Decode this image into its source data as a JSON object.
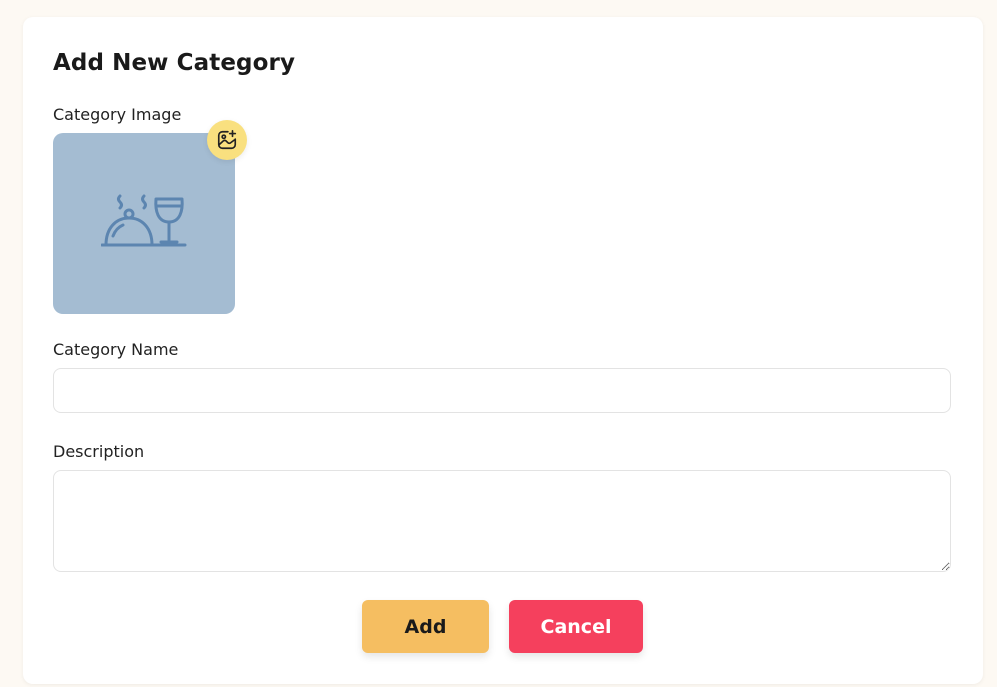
{
  "form": {
    "title": "Add New Category",
    "image_label": "Category Image",
    "name_label": "Category Name",
    "name_value": "",
    "name_placeholder": "",
    "description_label": "Description",
    "description_value": "",
    "description_placeholder": "",
    "add_label": "Add",
    "cancel_label": "Cancel"
  },
  "icons": {
    "image_placeholder": "food-cloche-wine-icon",
    "image_upload": "image-add-icon"
  },
  "colors": {
    "page_background": "#fdf9f3",
    "card_background": "#ffffff",
    "image_placeholder_bg": "#a4bcd2",
    "image_icon_stroke": "#5c85b0",
    "upload_button_bg": "#f9e07f",
    "add_button_bg": "#f5be61",
    "cancel_button_bg": "#f5405d"
  }
}
